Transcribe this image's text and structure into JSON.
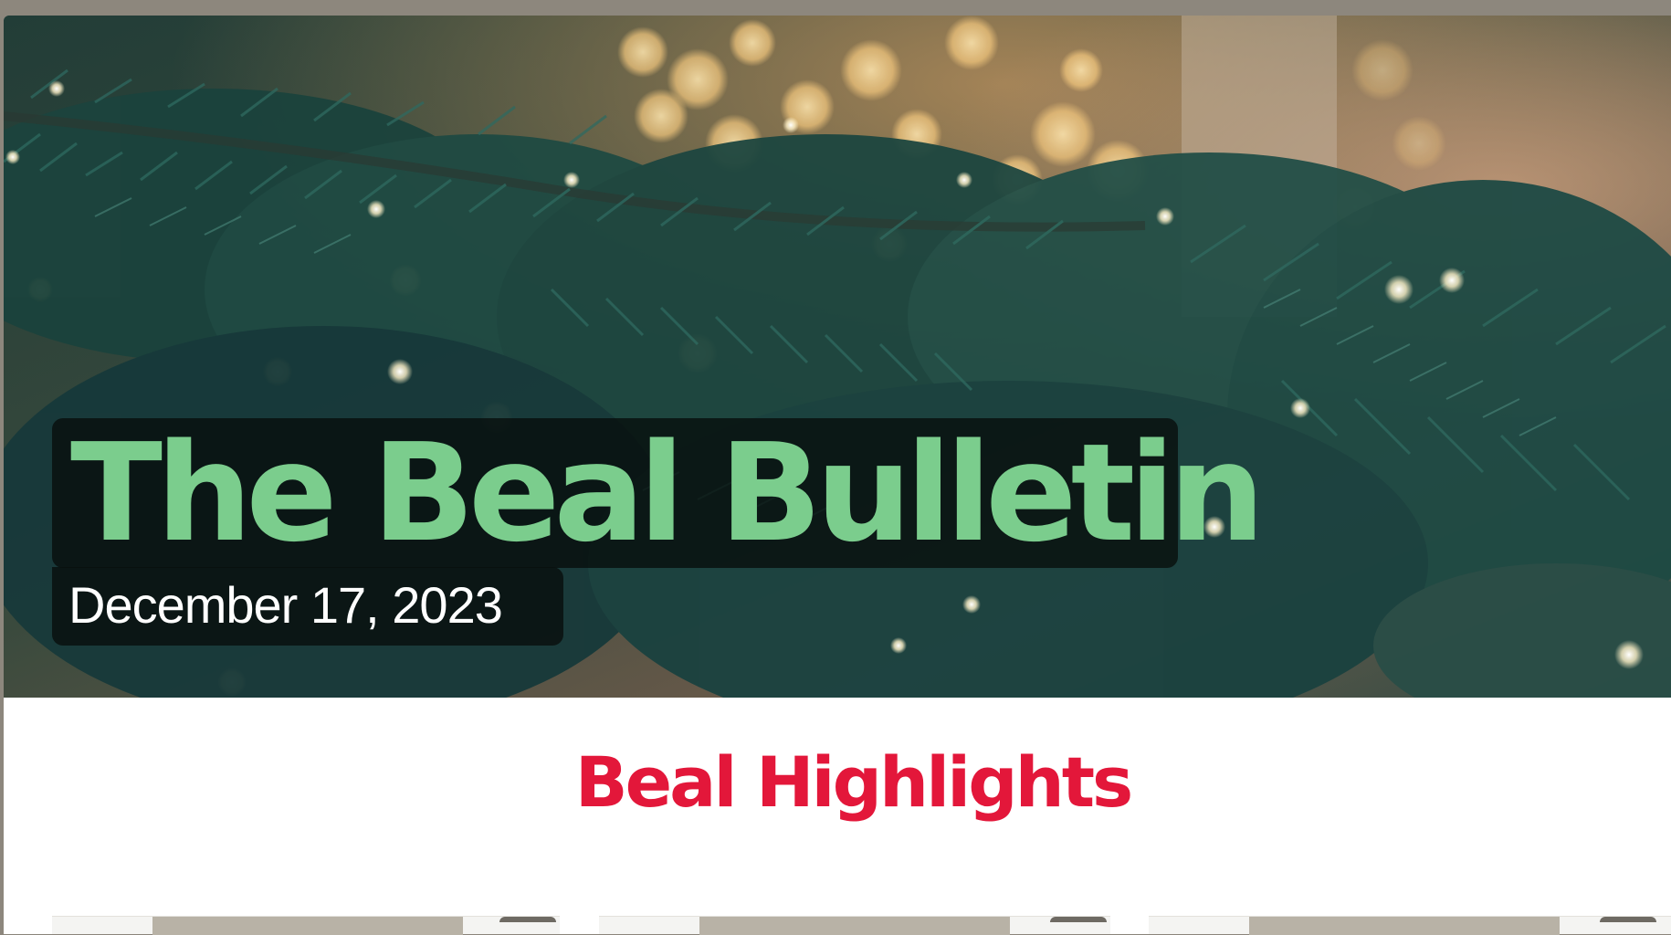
{
  "newsletter": {
    "title": "The Beal Bulletin",
    "date": "December 17, 2023",
    "section_heading": "Beal Highlights"
  },
  "hero": {
    "image_alt": "pine-branches-string-lights-icon"
  },
  "cards": [
    {
      "name": "highlight-card-1"
    },
    {
      "name": "highlight-card-2"
    },
    {
      "name": "highlight-card-3"
    }
  ],
  "colors": {
    "title": "#7bcd8d",
    "heading": "#e3173a",
    "date": "#ffffff"
  }
}
